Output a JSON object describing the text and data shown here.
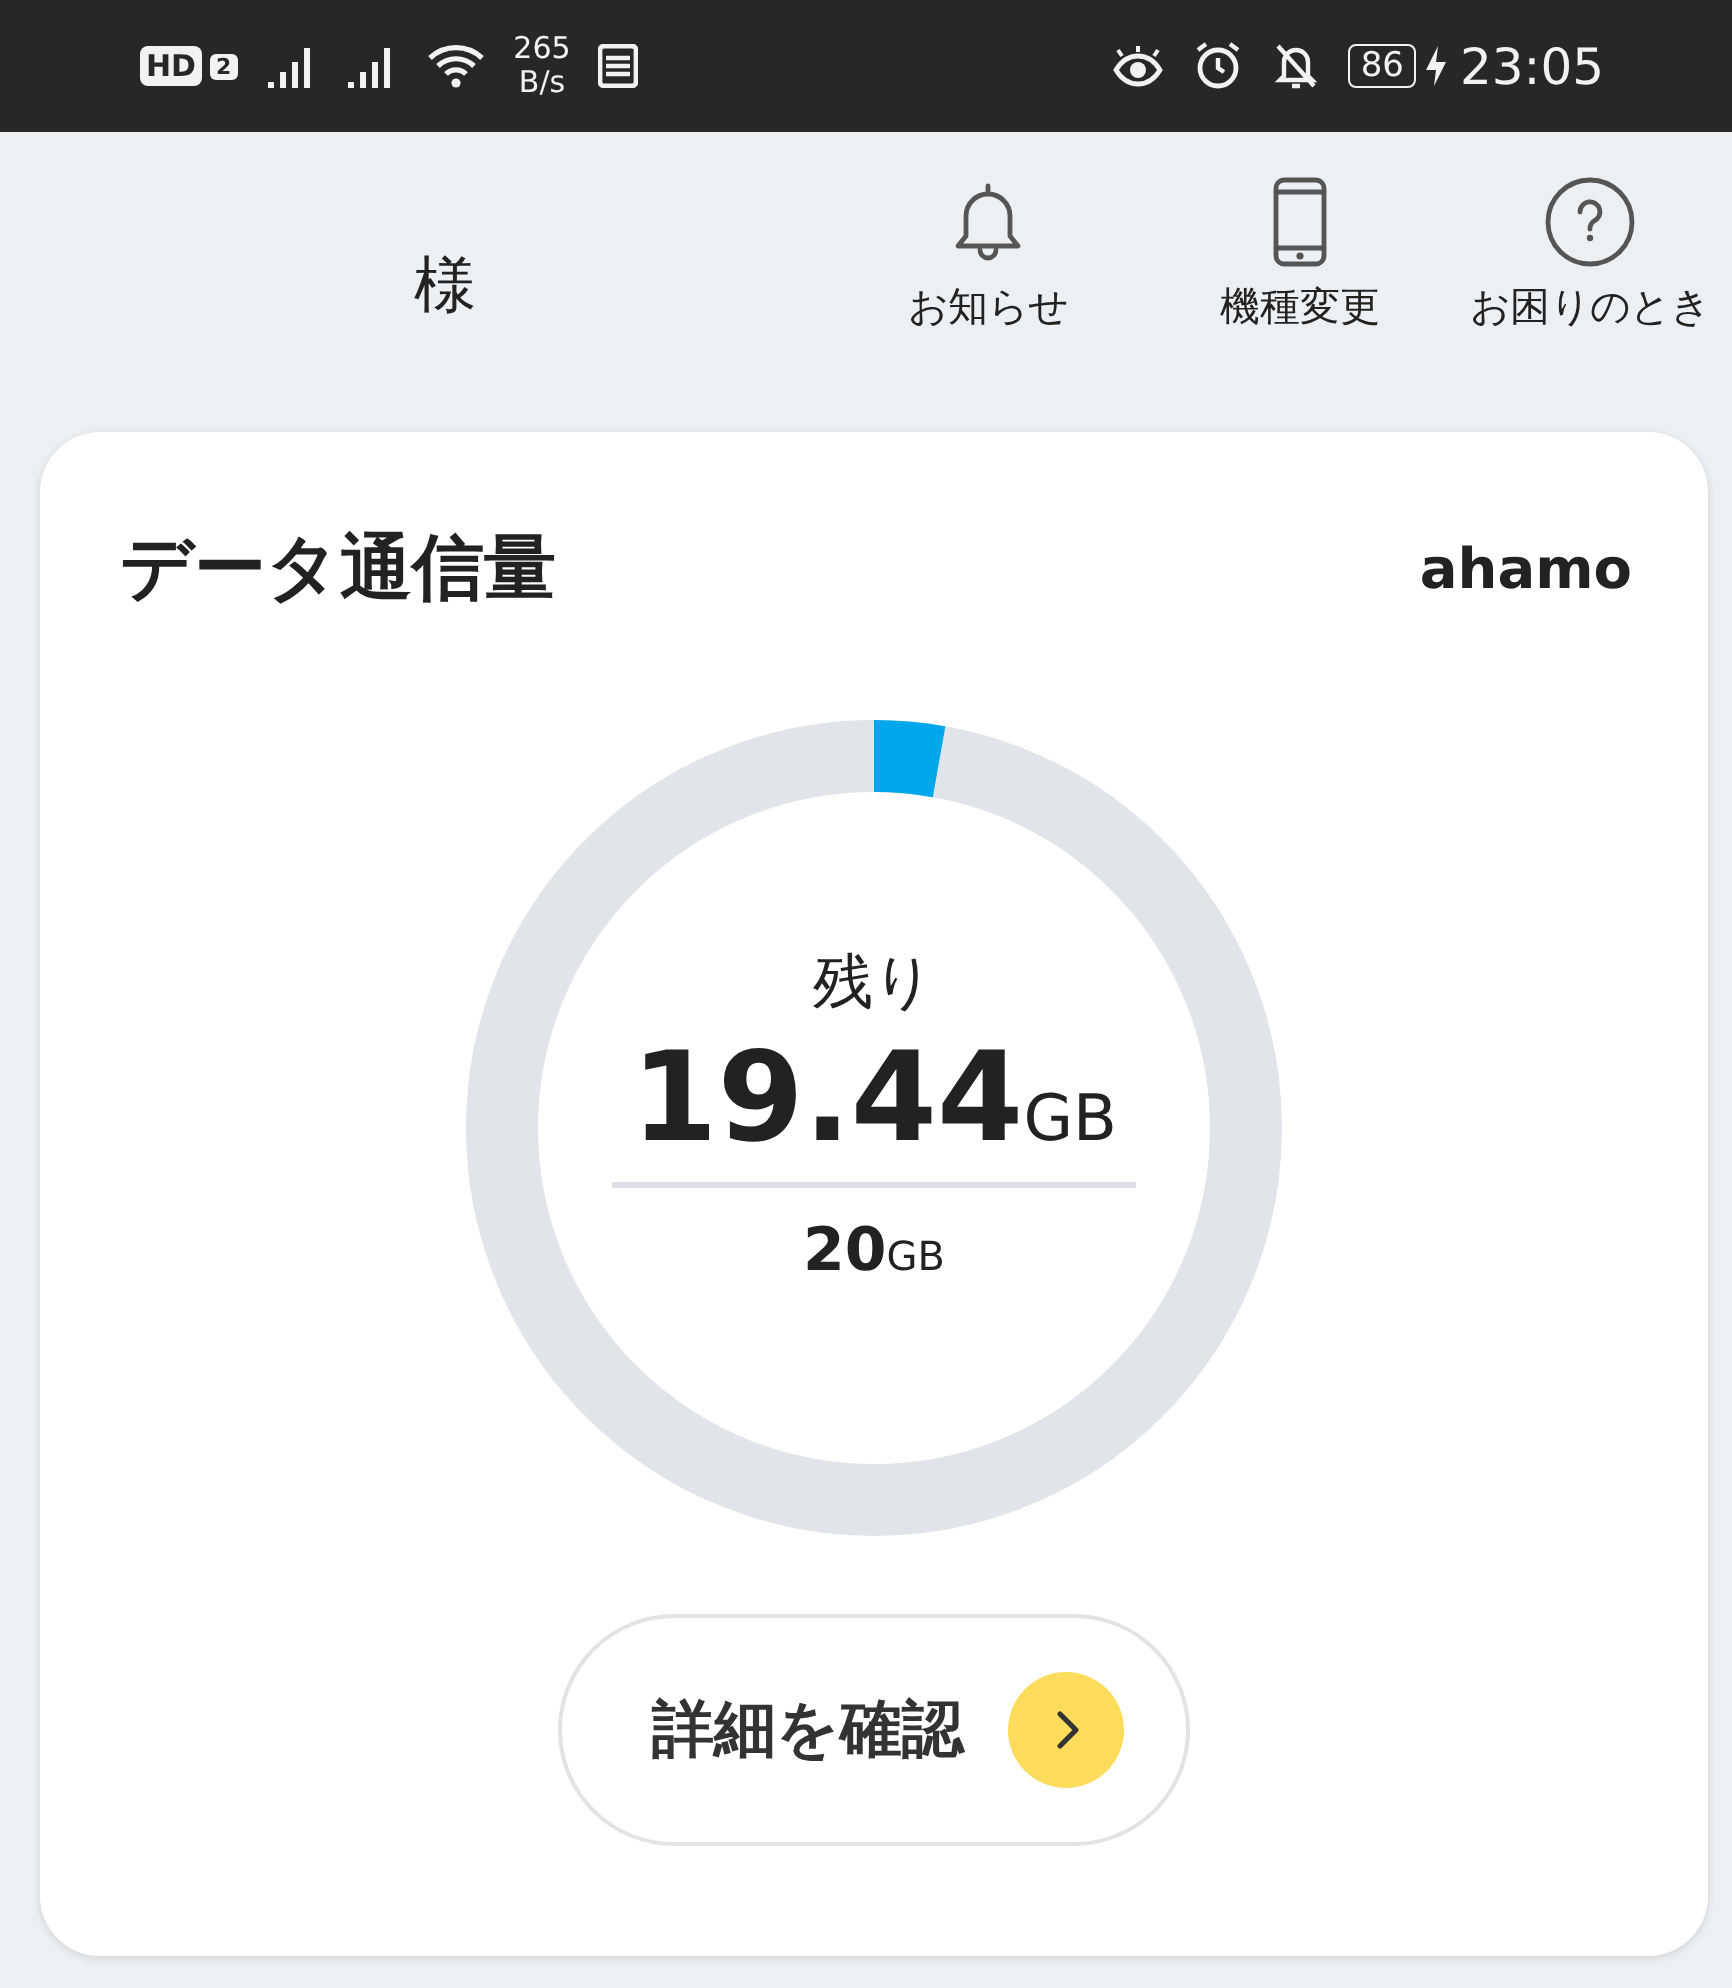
{
  "status_bar": {
    "hd_badge": "HD",
    "sim_number": "2",
    "net_speed": "265",
    "net_unit": "B/s",
    "battery": "86",
    "time": "23:05"
  },
  "header": {
    "honorific": "様",
    "nav": [
      {
        "kind": "bell",
        "label": "お知らせ"
      },
      {
        "kind": "phone",
        "label": "機種変更"
      },
      {
        "kind": "help",
        "label": "お困りのとき"
      }
    ]
  },
  "card": {
    "title": "データ通信量",
    "plan": "ahamo",
    "ring": {
      "level": 0.028
    },
    "remaining_label": "残り",
    "remaining_value": "19.44",
    "remaining_unit": "GB",
    "total_value": "20",
    "total_unit": "GB",
    "button": {
      "label": "詳細を確認"
    }
  }
}
